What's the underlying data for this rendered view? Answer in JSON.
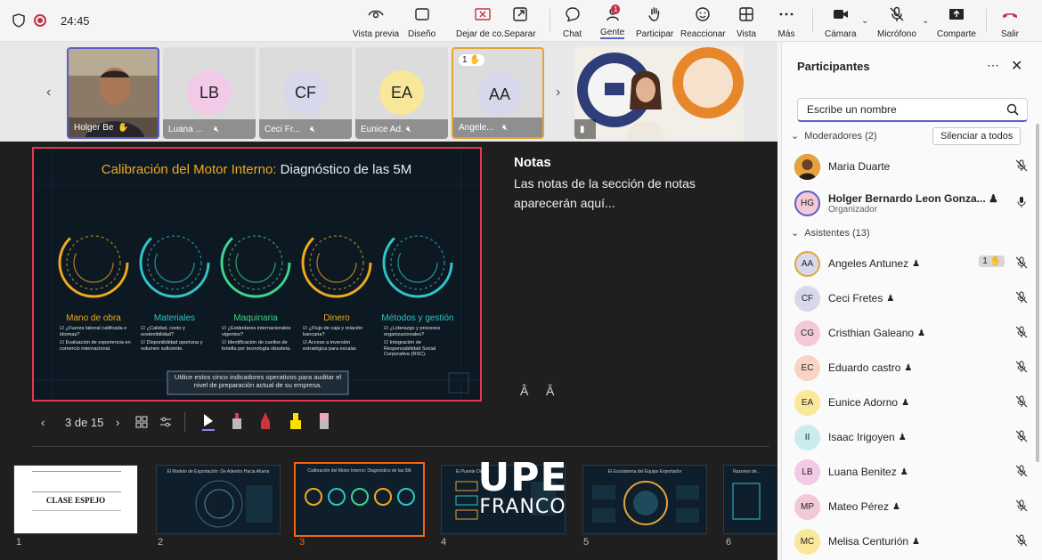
{
  "toolbar": {
    "timer": "24:45",
    "buttons": [
      {
        "label": "Vista previa"
      },
      {
        "label": "Diseño"
      },
      {
        "label": "Dejar de co..."
      },
      {
        "label": "Separar"
      },
      {
        "label": "Chat"
      },
      {
        "label": "Gente",
        "badge": "1"
      },
      {
        "label": "Participar"
      },
      {
        "label": "Reaccionar"
      },
      {
        "label": "Vista"
      },
      {
        "label": "Más"
      },
      {
        "label": "Cámara"
      },
      {
        "label": "Micrófono"
      },
      {
        "label": "Comparte"
      },
      {
        "label": "Salir"
      }
    ]
  },
  "video_strip": {
    "tiles": [
      {
        "name": "Holger Ber..."
      },
      {
        "name": "Luana ...",
        "initials": "LB"
      },
      {
        "name": "Ceci Fr...",
        "initials": "CF"
      },
      {
        "name": "Eunice Ad...",
        "initials": "EA"
      },
      {
        "name": "Angele...",
        "initials": "AA",
        "raised": "1"
      }
    ]
  },
  "slide": {
    "title_accent": "Calibración del Motor Interno:",
    "title_rest": " Diagnóstico de las 5M",
    "gauges": [
      {
        "label": "Mano de obra",
        "color": "#f0a91e",
        "bullets": [
          "¿Fuerza laboral calificada e idiomas?",
          "Evaluación de experiencia en comercio internacional."
        ]
      },
      {
        "label": "Materiales",
        "color": "#2ec4c8",
        "bullets": [
          "¿Calidad, costo y sostenibilidad?",
          "Disponibilidad oportuna y volumen suficiente."
        ]
      },
      {
        "label": "Maquinaria",
        "color": "#3ed48a",
        "bullets": [
          "¿Estándares internacionales vigentes?",
          "Identificación de cuellos de botella por tecnología obsoleta."
        ]
      },
      {
        "label": "Dinero",
        "color": "#f0a91e",
        "bullets": [
          "¿Flujo de caja y relación bancaria?",
          "Acceso a inversión estratégica para escalar."
        ]
      },
      {
        "label": "Métodos y gestión",
        "color": "#2ec4c8",
        "bullets": [
          "¿Liderazgo y procesos organizacionales?",
          "Integración de Responsabilidad Social Corporativa (RSC)."
        ]
      }
    ],
    "footer": "Utilice estos cinco indicadores operativos para auditar el nivel de preparación actual de su empresa."
  },
  "notes": {
    "title": "Notas",
    "body": "Las notas de la sección de notas aparecerán aquí..."
  },
  "slide_controls": {
    "counter": "3 de 15"
  },
  "thumbnails": [
    {
      "num": "1",
      "title": "CLASE ESPEJO"
    },
    {
      "num": "2",
      "title": "El Modelo de Exportación: De Adentro Hacia Afuera"
    },
    {
      "num": "3",
      "title": "Calibración del Motor Interno: Diagnóstico de las 5M"
    },
    {
      "num": "4",
      "title": "El Puente Digital"
    },
    {
      "num": "5",
      "title": "El Ecosistema del Equipo Exportador"
    },
    {
      "num": "6",
      "title": "Razones de..."
    }
  ],
  "watermark": {
    "line1": "UPE",
    "line2": "FRANCO"
  },
  "panel": {
    "title": "Participantes",
    "search_placeholder": "Escribe un nombre",
    "moderators_label": "Moderadores (2)",
    "mute_all": "Silenciar a todos",
    "attendees_label": "Asistentes (13)",
    "moderators": [
      {
        "name": "Maria Duarte",
        "initials": ""
      },
      {
        "name": "Holger Bernardo Leon Gonza...",
        "initials": "HG",
        "role": "Organizador"
      }
    ],
    "attendees": [
      {
        "name": "Angeles Antunez",
        "initials": "AA",
        "color": "#d8d8ec",
        "raised": "1"
      },
      {
        "name": "Ceci Fretes",
        "initials": "CF",
        "color": "#d8d8ec"
      },
      {
        "name": "Cristhian Galeano",
        "initials": "CG",
        "color": "#f2c9d4"
      },
      {
        "name": "Eduardo castro",
        "initials": "EC",
        "color": "#f7d4c6"
      },
      {
        "name": "Eunice Adorno",
        "initials": "EA",
        "color": "#f9e79a"
      },
      {
        "name": "Isaac Irigoyen",
        "initials": "II",
        "color": "#c9ecef"
      },
      {
        "name": "Luana Benitez",
        "initials": "LB",
        "color": "#f2c9e6"
      },
      {
        "name": "Mateo Pérez",
        "initials": "MP",
        "color": "#f2c9d4"
      },
      {
        "name": "Melisa Centurión",
        "initials": "MC",
        "color": "#f9e79a"
      }
    ]
  }
}
